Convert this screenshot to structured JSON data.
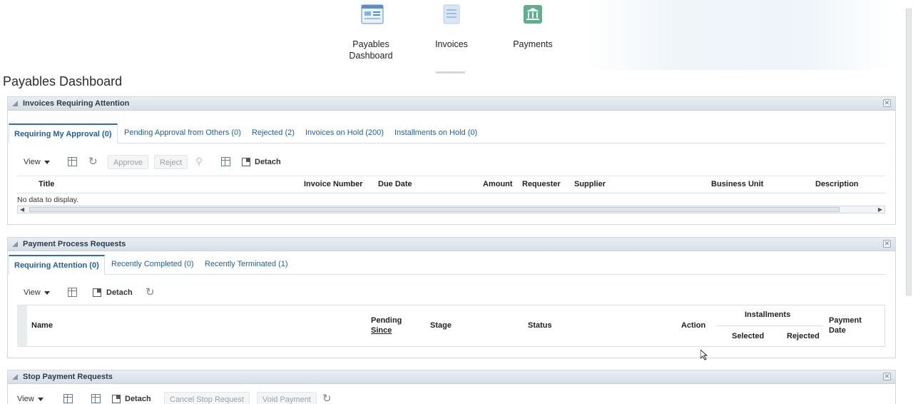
{
  "nav": {
    "items": [
      {
        "label_line1": "Payables",
        "label_line2": "Dashboard",
        "icon": "dashboard-icon"
      },
      {
        "label": "Invoices",
        "icon": "invoice-icon"
      },
      {
        "label": "Payments",
        "icon": "bank-icon"
      }
    ]
  },
  "page": {
    "title": "Payables Dashboard"
  },
  "invoices_panel": {
    "title": "Invoices Requiring Attention",
    "tabs": [
      "Requiring My Approval (0)",
      "Pending Approval from Others (0)",
      "Rejected (2)",
      "Invoices on Hold (200)",
      "Installments on Hold (0)"
    ],
    "toolbar": {
      "view": "View",
      "approve": "Approve",
      "reject": "Reject",
      "detach": "Detach"
    },
    "columns": [
      "Title",
      "Invoice Number",
      "Due Date",
      "Amount",
      "Requester",
      "Supplier",
      "Business Unit",
      "Description"
    ],
    "empty_message": "No data to display."
  },
  "ppr_panel": {
    "title": "Payment Process Requests",
    "tabs": [
      "Requiring Attention (0)",
      "Recently Completed (0)",
      "Recently Terminated (1)"
    ],
    "toolbar": {
      "view": "View",
      "detach": "Detach"
    },
    "columns": {
      "name": "Name",
      "pending_since_1": "Pending",
      "pending_since_2": "Since",
      "stage": "Stage",
      "status": "Status",
      "action": "Action",
      "installments": "Installments",
      "selected": "Selected",
      "rejected": "Rejected",
      "payment_date_1": "Payment",
      "payment_date_2": "Date"
    }
  },
  "stop_panel": {
    "title": "Stop Payment Requests",
    "toolbar": {
      "view": "View",
      "detach": "Detach",
      "cancel_stop": "Cancel Stop Request",
      "void_payment": "Void Payment"
    }
  },
  "colors": {
    "link": "#1d5f9e",
    "accent": "#2a6ebb",
    "panel_header": "#dbe3ea"
  }
}
